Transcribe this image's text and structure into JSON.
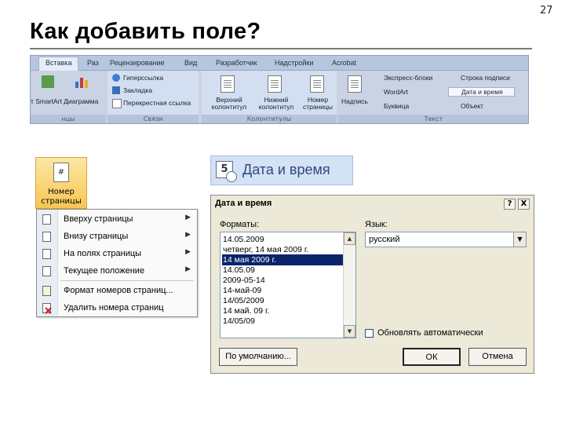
{
  "slide": {
    "number": "27",
    "title": "Как добавить поле?"
  },
  "ribbon": {
    "tabs": [
      "Вставка",
      "Раз",
      "Рецензирование",
      "Вид",
      "Разработчик",
      "Надстройки",
      "Acrobat"
    ],
    "groups": {
      "pages": {
        "items": [
          "т SmartArt Диаграмма"
        ],
        "label": "нцы"
      },
      "links": {
        "items": [
          "Гиперссылка",
          "Закладка",
          "Перекрестная ссылка"
        ],
        "label": "Связи"
      },
      "header_footer": {
        "items": [
          "Верхний колонтитул",
          "Нижний колонтитул",
          "Номер страницы"
        ],
        "label": "Колонтитулы"
      },
      "text": {
        "items": [
          "Надпись",
          "Экспресс-блоки",
          "WordArt",
          "Буквица",
          "Строка подписи",
          "Дата и время",
          "Объект"
        ],
        "label": "Текст"
      }
    }
  },
  "page_number_button": {
    "icon_glyph": "#",
    "label_line1": "Номер",
    "label_line2": "страницы"
  },
  "page_number_menu": {
    "items": [
      {
        "label": "Вверху страницы",
        "submenu": true
      },
      {
        "label": "Внизу страницы",
        "submenu": true
      },
      {
        "label": "На полях страницы",
        "submenu": true
      },
      {
        "label": "Текущее положение",
        "submenu": true
      },
      {
        "label": "Формат номеров страниц...",
        "submenu": false
      },
      {
        "label": "Удалить номера страниц",
        "submenu": false
      }
    ]
  },
  "datetime_button": {
    "icon_glyph": "5",
    "label": "Дата и время"
  },
  "dialog": {
    "title": "Дата и время",
    "help_btn": "?",
    "close_btn": "X",
    "formats_label": "Форматы:",
    "language_label": "Язык:",
    "formats": [
      "14.05.2009",
      "четверг, 14 мая 2009 г.",
      "14 мая 2009 г.",
      "14.05.09",
      "2009-05-14",
      "14-май-09",
      "14/05/2009",
      "14 май. 09 г.",
      "14/05/09"
    ],
    "selected_index": 2,
    "language_value": "русский",
    "auto_update_label": "Обновлять автоматически",
    "auto_update_checked": false,
    "default_btn": "По умолчанию...",
    "ok_btn": "ОК",
    "cancel_btn": "Отмена"
  }
}
